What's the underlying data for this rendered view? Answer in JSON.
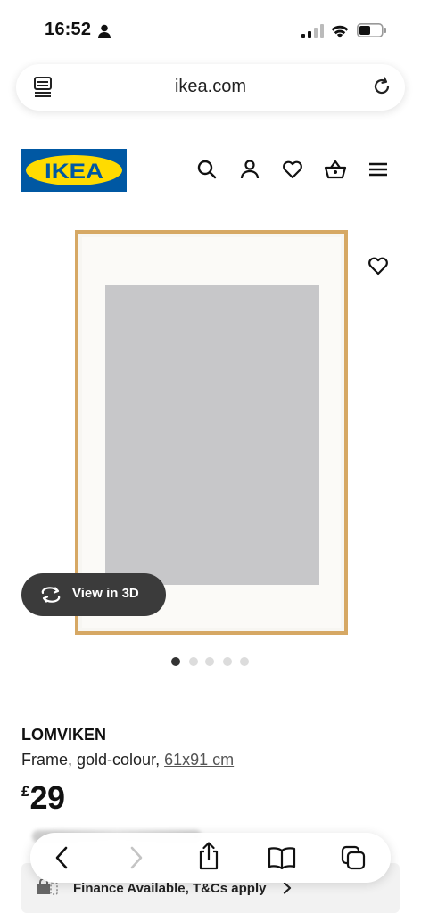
{
  "status_bar": {
    "time": "16:52",
    "icons": [
      "person-icon",
      "signal-icon",
      "wifi-icon",
      "battery-icon"
    ]
  },
  "browser": {
    "url": "ikea.com",
    "toolbar_icons": [
      "back-icon",
      "forward-icon",
      "share-icon",
      "bookmarks-icon",
      "tabs-icon"
    ]
  },
  "header": {
    "logo_text": "IKEA",
    "brand_colors": {
      "blue": "#0058a3",
      "yellow": "#ffdb00"
    },
    "icons": [
      "search-icon",
      "account-icon",
      "wishlist-icon",
      "basket-icon",
      "menu-icon"
    ]
  },
  "gallery": {
    "view_3d_label": "View in 3D",
    "image_count": 5,
    "active_index": 0,
    "frame_color": "#d6a864"
  },
  "product": {
    "name": "LOMVIKEN",
    "description": "Frame, gold-colour,",
    "size": "61x91 cm",
    "currency": "£",
    "price": "29"
  },
  "finance": {
    "label": "Finance Available, T&Cs apply"
  }
}
